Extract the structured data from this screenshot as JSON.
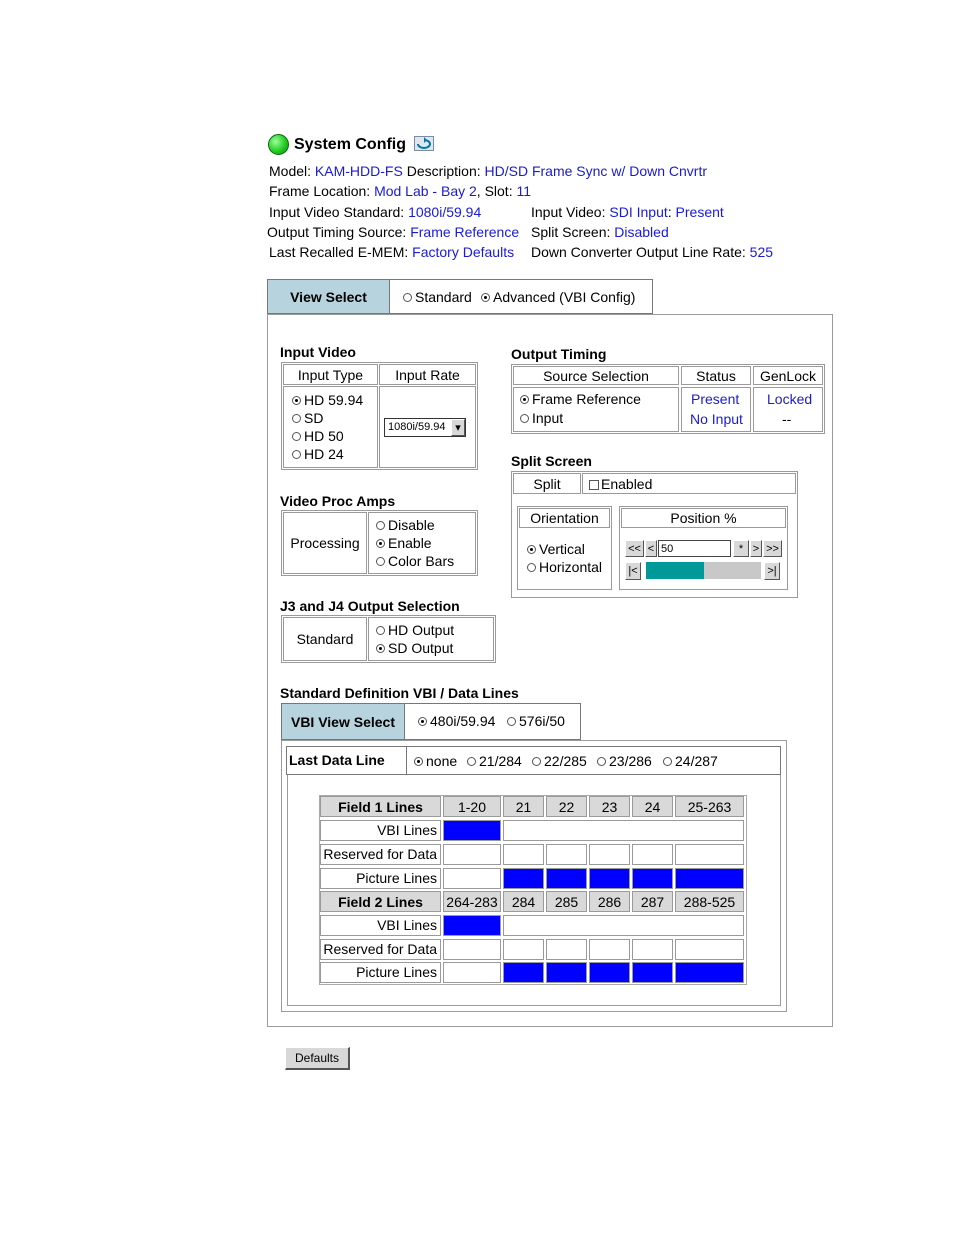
{
  "header": {
    "title": "System Config",
    "model_label": "Model:",
    "model_value": "KAM-HDD-FS",
    "desc_label": "Description:",
    "desc_value": "HD/SD Frame Sync w/ Down Cnvrtr",
    "frame_loc_label": "Frame Location:",
    "frame_loc_value": "Mod Lab - Bay 2",
    "slot_label": ", Slot:",
    "slot_value": "11",
    "input_std_label": "Input Video Standard:",
    "input_std_value": "1080i/59.94",
    "input_video_label": "Input Video:",
    "input_video_value": "SDI Input",
    "input_video_sep": ":",
    "input_video_status": "Present",
    "out_timing_label": "Output Timing Source:",
    "out_timing_value": "Frame Reference",
    "split_label": "Split Screen:",
    "split_value": "Disabled",
    "emem_label": "Last Recalled E-MEM:",
    "emem_value": "Factory Defaults",
    "dc_label": "Down Converter Output Line Rate:",
    "dc_value": "525",
    "status_color": "#22cc22"
  },
  "view_select": {
    "label": "View Select",
    "opt_standard": "Standard",
    "opt_advanced": "Advanced (VBI Config)",
    "selected": "advanced"
  },
  "input_video": {
    "title": "Input Video",
    "col_type": "Input Type",
    "col_rate": "Input Rate",
    "types": [
      "HD 59.94",
      "SD",
      "HD 50",
      "HD 24"
    ],
    "selected_index": 0,
    "rate_value": "1080i/59.94"
  },
  "output_timing": {
    "title": "Output Timing",
    "col_source": "Source Selection",
    "col_status": "Status",
    "col_genlock": "GenLock",
    "opt_frame_ref": "Frame Reference",
    "opt_input": "Input",
    "status_frame_ref": "Present",
    "status_input": "No Input",
    "genlock_frame_ref": "Locked",
    "genlock_input": "--"
  },
  "split_screen": {
    "title": "Split Screen",
    "split_label": "Split",
    "enabled_label": "Enabled",
    "orientation_label": "Orientation",
    "opt_vertical": "Vertical",
    "opt_horizontal": "Horizontal",
    "position_label": "Position %",
    "position_value": "50",
    "btn_first": "<<",
    "btn_prev": "<",
    "btn_set": "*",
    "btn_next": ">",
    "btn_last": ">>",
    "slider_left": "|<",
    "slider_right": ">|",
    "slider_fill_percent": 50,
    "slider_color": "#009999"
  },
  "proc_amps": {
    "title": "Video Proc Amps",
    "row_label": "Processing",
    "opt_disable": "Disable",
    "opt_enable": "Enable",
    "opt_colorbars": "Color Bars"
  },
  "j3j4": {
    "title": "J3 and J4 Output Selection",
    "row_label": "Standard",
    "opt_hd": "HD Output",
    "opt_sd": "SD Output"
  },
  "vbi": {
    "title": "Standard Definition VBI / Data Lines",
    "view_label": "VBI View Select",
    "opt_480": "480i/59.94",
    "opt_576": "576i/50",
    "last_line_label": "Last Data Line",
    "last_line_opts": [
      "none",
      "21/284",
      "22/285",
      "23/286",
      "24/287"
    ],
    "field1_label": "Field 1 Lines",
    "field1_cols": [
      "1-20",
      "21",
      "22",
      "23",
      "24",
      "25-263"
    ],
    "field2_label": "Field 2 Lines",
    "field2_cols": [
      "264-283",
      "284",
      "285",
      "286",
      "287",
      "288-525"
    ],
    "row_vbi": "VBI Lines",
    "row_reserved": "Reserved for Data",
    "row_picture": "Picture Lines",
    "highlight_color": "#0000ff"
  },
  "footer": {
    "defaults_button": "Defaults"
  }
}
